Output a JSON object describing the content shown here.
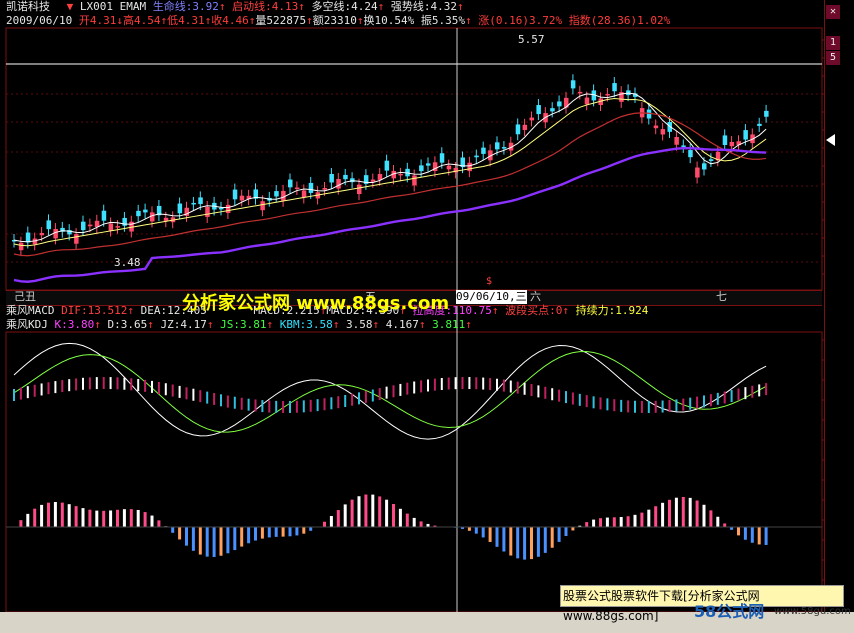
{
  "header": {
    "stock_name": "凯诺科技",
    "formula": "LX001",
    "formula2": "EMAM",
    "lifeline_label": "生命线:",
    "lifeline_val": "3.92",
    "start_label": "启动线:",
    "start_val": "4.13",
    "longshort_label": "多空线:",
    "longshort_val": "4.24",
    "trend_label": "强势线:",
    "trend_val": "4.32"
  },
  "quote": {
    "date": "2009/06/10",
    "open_label": "开",
    "open": "4.31",
    "high_label": "高",
    "high": "4.54",
    "low_label": "低",
    "low": "4.31",
    "close_label": "收",
    "close": "4.46",
    "vol_label": "量",
    "vol": "522875",
    "amt_label": "额",
    "amt": "23310",
    "turn_label": "换",
    "turn": "10.54%",
    "amp_label": "振",
    "amp": "5.35%",
    "chg_label": "涨",
    "chg": "(0.16)",
    "chg_pct": "3.72%",
    "index_label": "指数",
    "index": "(28.36)",
    "index_pct": "1.02%"
  },
  "price_marks": {
    "max": "5.57",
    "min": "3.48"
  },
  "dates": {
    "m1": "己丑",
    "m2": "五",
    "m3": "六",
    "m4": "七",
    "cursor": "09/06/10,三",
    "flag": "$"
  },
  "macd": {
    "name": "乘风MACD",
    "dif_label": "DIF:",
    "dif": "13.512",
    "dea_label": "DEA:",
    "dea": "12.405",
    "macd_label": "MACD:",
    "macd": "2.215",
    "macd2_label": "MACD2:",
    "macd2": "4.390",
    "hot_label": "拉高度:",
    "hot": "110.75",
    "buy_label": "波段买点:",
    "buy": "0",
    "persist_label": "持续力:",
    "persist": "1.924"
  },
  "kdj": {
    "name": "乘风KDJ",
    "k_label": "K:",
    "k": "3.80",
    "d_label": "D:",
    "d": "3.65",
    "jz_label": "JZ:",
    "jz": "4.17",
    "js_label": "JS:",
    "js": "3.81",
    "kbm_label": "KBM:",
    "kbm": "3.58",
    "v1": "3.58",
    "v2": "4.167",
    "v3": "3.811"
  },
  "right_panel": {
    "btn1": "1",
    "btn2": "5"
  },
  "watermark": "分析家公式网 www.88gs.com",
  "ad": "股票公式股票软件下载[分析家公式网www.88gs.com]",
  "logo": {
    "brand": "58公式网",
    "url": "www.58gu.com"
  }
}
